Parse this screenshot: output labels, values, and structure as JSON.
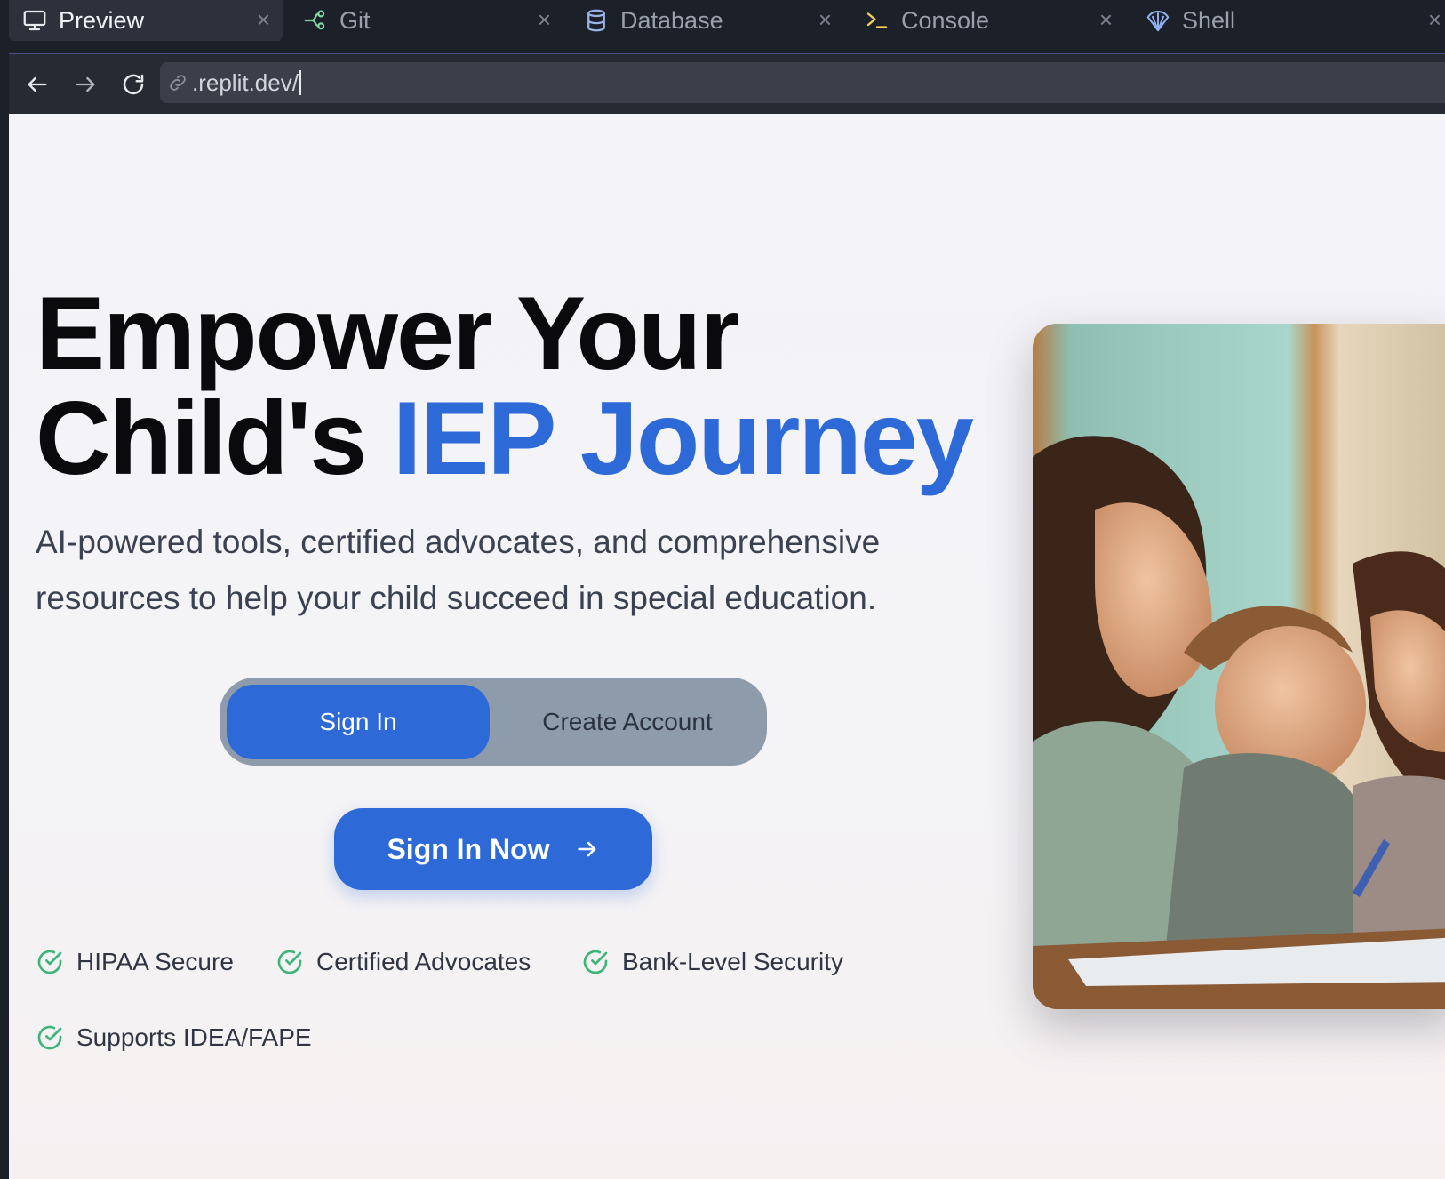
{
  "tabs": [
    {
      "label": "Preview",
      "icon": "monitor-icon",
      "active": true
    },
    {
      "label": "Git",
      "icon": "git-branch-icon",
      "active": false
    },
    {
      "label": "Database",
      "icon": "database-icon",
      "active": false
    },
    {
      "label": "Console",
      "icon": "terminal-icon",
      "active": false
    },
    {
      "label": "Shell",
      "icon": "shell-icon",
      "active": false
    }
  ],
  "browser": {
    "url": ".replit.dev/"
  },
  "hero": {
    "headline_line1": "Empower Your",
    "headline_line2_plain": "Child's ",
    "headline_line2_accent": "IEP Journey",
    "subtitle": "AI-powered tools, certified advocates, and comprehensive resources to help your child succeed in special education.",
    "image_alt": "Mother smiling with two children writing at a desk in a classroom"
  },
  "auth": {
    "toggle_sign_in": "Sign In",
    "toggle_create_account": "Create Account",
    "selected": "Sign In",
    "primary_button": "Sign In Now"
  },
  "trust_badges": [
    "HIPAA Secure",
    "Certified Advocates",
    "Bank-Level Security",
    "Supports IDEA/FAPE"
  ],
  "colors": {
    "accent": "#2d6ad8",
    "check_green": "#3fb47a",
    "toggle_bg": "#8e9bab",
    "ide_bg": "#1c2029"
  }
}
